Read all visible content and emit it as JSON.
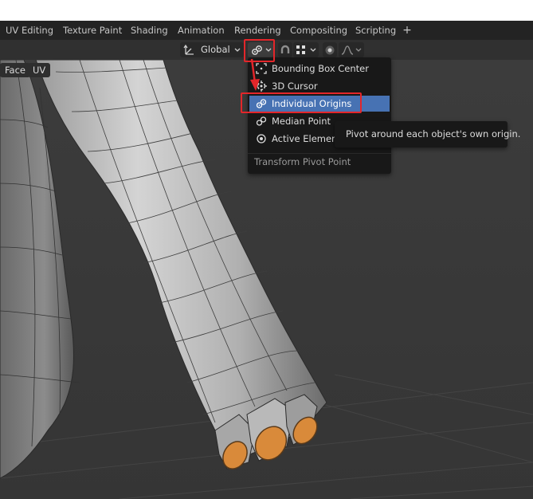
{
  "workspace_tabs": [
    "UV Editing",
    "Texture Paint",
    "Shading",
    "Animation",
    "Rendering",
    "Compositing",
    "Scripting"
  ],
  "add_tab_label": "+",
  "header": {
    "orientation_label": "Global"
  },
  "viewport_buttons": {
    "face_label": "Face",
    "uv_label": "UV"
  },
  "pivot_menu": {
    "items": [
      {
        "label": "Bounding Box Center",
        "icon": "bounding-box-icon"
      },
      {
        "label": "3D Cursor",
        "icon": "cursor-3d-icon"
      },
      {
        "label": "Individual Origins",
        "icon": "individual-origins-icon",
        "active": true
      },
      {
        "label": "Median Point",
        "icon": "median-point-icon"
      },
      {
        "label": "Active Element",
        "icon": "active-element-icon"
      }
    ],
    "title": "Transform Pivot Point"
  },
  "tooltip": "Pivot around each object's own origin.",
  "colors": {
    "highlight": "#4772b3",
    "annotation_red": "#e3262a",
    "cap_orange": "#d98a3a"
  }
}
